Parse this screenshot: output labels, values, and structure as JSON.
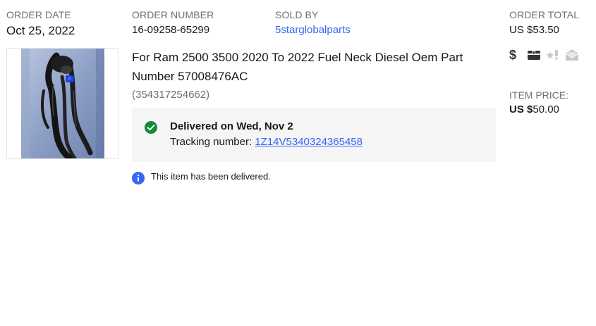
{
  "order_date": {
    "label": "ORDER DATE",
    "value": "Oct 25, 2022"
  },
  "order_number": {
    "label": "ORDER NUMBER",
    "value": "16-09258-65299"
  },
  "sold_by": {
    "label": "SOLD BY",
    "value": "5starglobalparts"
  },
  "order_total": {
    "label": "ORDER TOTAL",
    "currency": "US $",
    "amount": "53.50"
  },
  "item": {
    "title": "For Ram 2500 3500 2020 To 2022 Fuel Neck Diesel Oem Part Number 57008476AC",
    "id": "(354317254662)",
    "image_icon": "product-photo-fuel-neck"
  },
  "delivery": {
    "status": "Delivered on Wed, Nov 2",
    "tracking_label": "Tracking number:",
    "tracking_number": "1Z14V5340324365458",
    "status_icon": "check-circle-icon",
    "status_color": "#118a3c"
  },
  "info_message": {
    "text": "This item has been delivered.",
    "icon": "info-icon",
    "icon_color": "#3665f3"
  },
  "actions": [
    {
      "icon": "dollar-icon",
      "state": "active"
    },
    {
      "icon": "package-icon",
      "state": "active"
    },
    {
      "icon": "feedback-star-icon",
      "state": "disabled"
    },
    {
      "icon": "message-envelope-icon",
      "state": "disabled"
    }
  ],
  "item_price": {
    "label": "ITEM PRICE:",
    "currency": "US $",
    "amount": "50.00"
  },
  "colors": {
    "link": "#3665f3",
    "label_gray": "#707070",
    "delivery_bg": "#f5f5f5",
    "icon_active": "#333333",
    "icon_disabled": "#c7c7c7"
  }
}
